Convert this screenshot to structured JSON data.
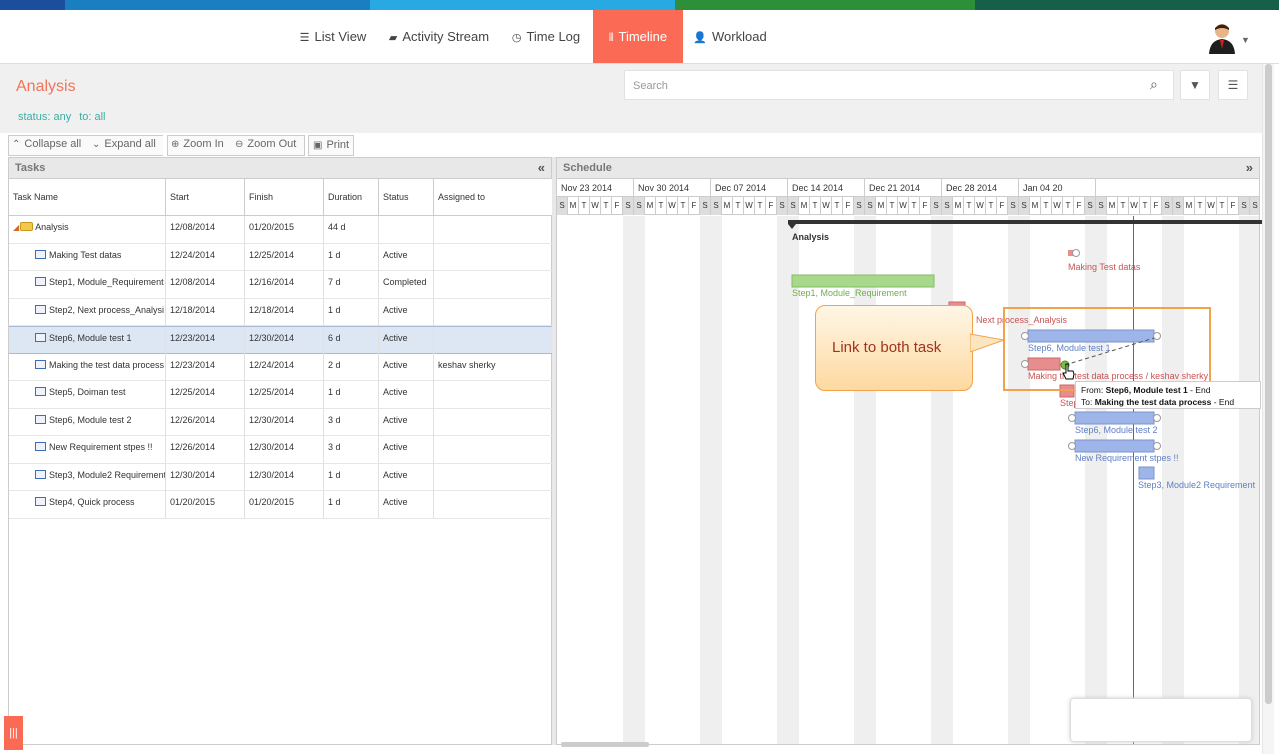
{
  "colors": {
    "accent": "#fa6a55",
    "title": "#f07458",
    "filter": "#3caea3",
    "blue_bar": "#9db5e8",
    "red_bar": "#e88d8d",
    "green_bar": "#a8d98a",
    "today_line": "#e0304f"
  },
  "nav": {
    "items": [
      {
        "label": "List View",
        "icon": "list-icon"
      },
      {
        "label": "Activity Stream",
        "icon": "comment-icon"
      },
      {
        "label": "Time Log",
        "icon": "clock-icon"
      },
      {
        "label": "Timeline",
        "icon": "timeline-icon"
      },
      {
        "label": "Workload",
        "icon": "user-icon"
      }
    ],
    "active": "Timeline"
  },
  "project": {
    "title": "Analysis",
    "filter_status": "status: any",
    "filter_to": "to: all"
  },
  "search": {
    "placeholder": "Search"
  },
  "toolbar": {
    "collapse": "Collapse all",
    "expand": "Expand all",
    "zoom_in": "Zoom In",
    "zoom_out": "Zoom Out",
    "print": "Print"
  },
  "tasks_panel": {
    "title": "Tasks",
    "columns": [
      "Task Name",
      "Start",
      "Finish",
      "Duration",
      "Status",
      "Assigned to"
    ],
    "rows": [
      {
        "name": "Analysis",
        "start": "12/08/2014",
        "finish": "01/20/2015",
        "duration": "44 d",
        "status": "",
        "assigned": "",
        "parent": true
      },
      {
        "name": "Making Test datas",
        "start": "12/24/2014",
        "finish": "12/25/2014",
        "duration": "1 d",
        "status": "Active",
        "assigned": ""
      },
      {
        "name": "Step1, Module_Requirement",
        "start": "12/08/2014",
        "finish": "12/16/2014",
        "duration": "7 d",
        "status": "Completed",
        "assigned": ""
      },
      {
        "name": "Step2, Next process_Analysi",
        "start": "12/18/2014",
        "finish": "12/18/2014",
        "duration": "1 d",
        "status": "Active",
        "assigned": ""
      },
      {
        "name": "Step6, Module test 1",
        "start": "12/23/2014",
        "finish": "12/30/2014",
        "duration": "6 d",
        "status": "Active",
        "assigned": "",
        "selected": true
      },
      {
        "name": "Making the test data process",
        "start": "12/23/2014",
        "finish": "12/24/2014",
        "duration": "2 d",
        "status": "Active",
        "assigned": "keshav sherky"
      },
      {
        "name": "Step5, Doiman test",
        "start": "12/25/2014",
        "finish": "12/25/2014",
        "duration": "1 d",
        "status": "Active",
        "assigned": ""
      },
      {
        "name": "Step6, Module test 2",
        "start": "12/26/2014",
        "finish": "12/30/2014",
        "duration": "3 d",
        "status": "Active",
        "assigned": ""
      },
      {
        "name": "New Requirement stpes !!",
        "start": "12/26/2014",
        "finish": "12/30/2014",
        "duration": "3 d",
        "status": "Active",
        "assigned": ""
      },
      {
        "name": "Step3, Module2 Requirement",
        "start": "12/30/2014",
        "finish": "12/30/2014",
        "duration": "1 d",
        "status": "Active",
        "assigned": ""
      },
      {
        "name": "Step4, Quick process",
        "start": "01/20/2015",
        "finish": "01/20/2015",
        "duration": "1 d",
        "status": "Active",
        "assigned": ""
      }
    ]
  },
  "schedule": {
    "title": "Schedule",
    "weeks": [
      "Nov 23 2014",
      "Nov 30 2014",
      "Dec 07 2014",
      "Dec 14 2014",
      "Dec 21 2014",
      "Dec 28 2014",
      "Jan 04 20"
    ],
    "day_letters": [
      "S",
      "M",
      "T",
      "W",
      "T",
      "F",
      "S"
    ],
    "gantt_labels": {
      "summary": "Analysis",
      "making_test": "Making Test datas",
      "step1": "Step1, Module_Requirement",
      "step2": "Next process_Analysis",
      "step6_1": "Step6, Module test 1",
      "making_process": "Making the test data process / keshav sherky",
      "step5": "Step",
      "step6_2": "Step6, Module test 2",
      "new_req": "New Requirement stpes !!",
      "step3": "Step3, Module2 Requirement"
    }
  },
  "callout": {
    "text": "Link to both task"
  },
  "tooltip": {
    "from_prefix": "From: ",
    "from_task": "Step6, Module test 1",
    "from_suffix": " - End",
    "to_prefix": "To: ",
    "to_task": "Making the test data process",
    "to_suffix": " - End"
  }
}
